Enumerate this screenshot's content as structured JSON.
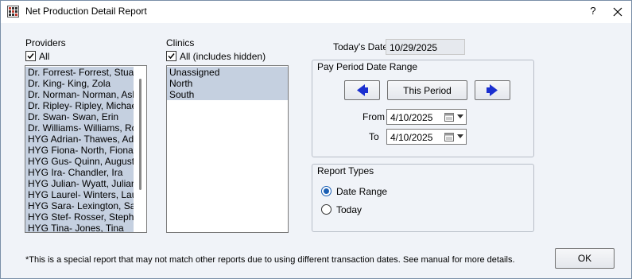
{
  "window": {
    "title": "Net Production Detail Report",
    "help_label": "?",
    "close_icon": "close-icon"
  },
  "providers": {
    "label": "Providers",
    "all_label": "All",
    "all_checked": true,
    "items": [
      "Dr. Forrest- Forrest, Stuart",
      "Dr. King- King, Zola",
      "Dr. Norman- Norman, Ashley",
      "Dr. Ripley- Ripley, Michael",
      "Dr. Swan- Swan, Erin",
      "Dr. Williams- Williams, Rob",
      "HYG Adrian- Thawes, Adrian",
      "HYG Fiona- North, Fiona",
      "HYG Gus- Quinn, Augustus",
      "HYG Ira- Chandler, Ira",
      "HYG Julian- Wyatt, Julian",
      "HYG Laurel- Winters, Laurel",
      "HYG Sara- Lexington, Sara",
      "HYG Stef- Rosser, Stephanie",
      "HYG Tina- Jones, Tina"
    ]
  },
  "clinics": {
    "label": "Clinics",
    "all_label": "All (includes hidden)",
    "all_checked": true,
    "items": [
      "Unassigned",
      "North",
      "South"
    ]
  },
  "todays_date": {
    "label": "Today's Date",
    "value": "10/29/2025"
  },
  "pay_period": {
    "group_label": "Pay Period Date Range",
    "prev_icon": "arrow-left-icon",
    "this_period_label": "This Period",
    "next_icon": "arrow-right-icon",
    "from_label": "From",
    "from_value": "4/10/2025",
    "to_label": "To",
    "to_value": "4/10/2025"
  },
  "report_types": {
    "group_label": "Report Types",
    "options": [
      {
        "label": "Date Range",
        "selected": true
      },
      {
        "label": "Today",
        "selected": false
      }
    ]
  },
  "footer": {
    "note": "*This is a special report that may not match other reports due to using different transaction dates.  See manual for more details.",
    "ok_label": "OK"
  },
  "colors": {
    "selection": "#c5d0e0",
    "accent": "#1a5fb4",
    "arrow_fill": "#1a2fd0"
  }
}
